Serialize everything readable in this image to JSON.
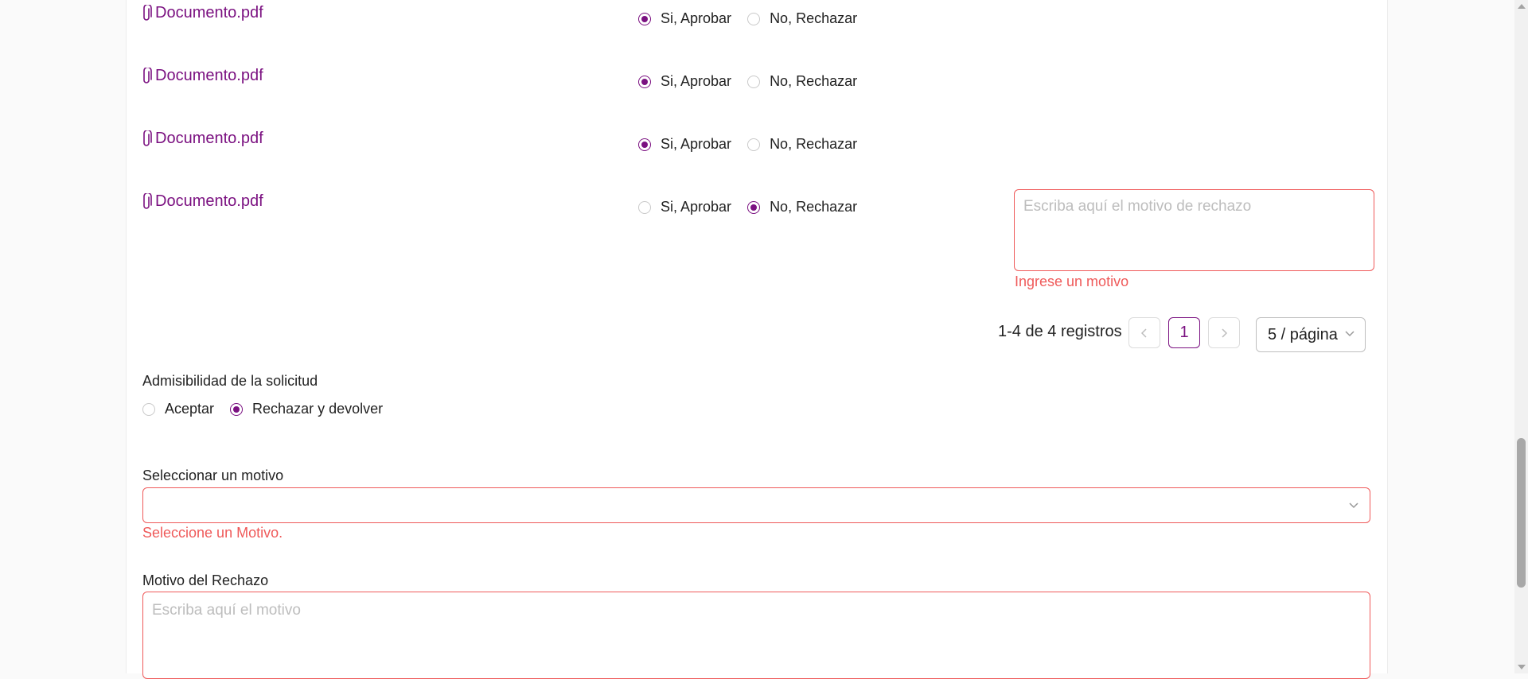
{
  "documents": [
    {
      "name": "Documento.pdf",
      "approve_label": "Si, Aprobar",
      "reject_label": "No, Rechazar",
      "selected": "approve"
    },
    {
      "name": "Documento.pdf",
      "approve_label": "Si, Aprobar",
      "reject_label": "No, Rechazar",
      "selected": "approve"
    },
    {
      "name": "Documento.pdf",
      "approve_label": "Si, Aprobar",
      "reject_label": "No, Rechazar",
      "selected": "approve"
    },
    {
      "name": "Documento.pdf",
      "approve_label": "Si, Aprobar",
      "reject_label": "No, Rechazar",
      "selected": "reject",
      "reject_reason_placeholder": "Escriba aquí el motivo de rechazo",
      "reject_reason_error": "Ingrese un motivo"
    }
  ],
  "pagination": {
    "summary": "1-4 de 4 registros",
    "prev_icon": "chevron-left-icon",
    "current_page": "1",
    "next_icon": "chevron-right-icon",
    "page_size": "5 / página"
  },
  "admissibility": {
    "label": "Admisibilidad de la solicitud",
    "accept_label": "Aceptar",
    "reject_label": "Rechazar y devolver",
    "selected": "reject"
  },
  "reason_select": {
    "label": "Seleccionar un motivo",
    "value": "",
    "error": "Seleccione un Motivo."
  },
  "rejection_reason": {
    "label": "Motivo del Rechazo",
    "placeholder": "Escriba aquí el motivo"
  },
  "colors": {
    "accent": "#7b1181",
    "error": "#ef5a5a"
  }
}
